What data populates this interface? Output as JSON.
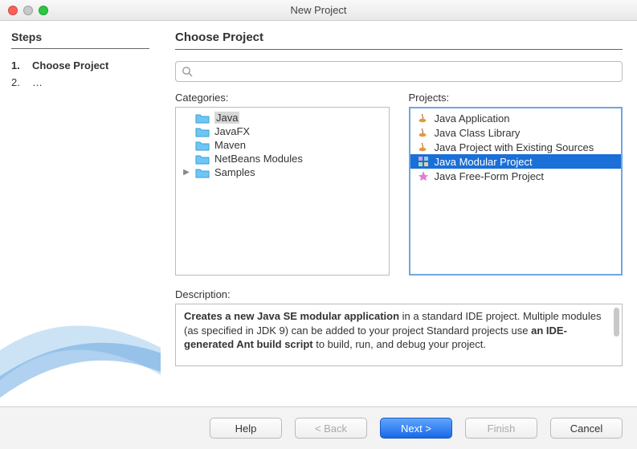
{
  "window": {
    "title": "New Project"
  },
  "steps": {
    "heading": "Steps",
    "items": [
      {
        "num": "1.",
        "label": "Choose Project",
        "current": true
      },
      {
        "num": "2.",
        "label": "…",
        "current": false
      }
    ]
  },
  "content": {
    "heading": "Choose Project",
    "search": {
      "placeholder": ""
    },
    "categories_label": "Categories:",
    "projects_label": "Projects:",
    "categories": [
      {
        "label": "Java",
        "expandable": false,
        "selected": true
      },
      {
        "label": "JavaFX",
        "expandable": false,
        "selected": false
      },
      {
        "label": "Maven",
        "expandable": false,
        "selected": false
      },
      {
        "label": "NetBeans Modules",
        "expandable": false,
        "selected": false
      },
      {
        "label": "Samples",
        "expandable": true,
        "selected": false
      }
    ],
    "projects": [
      {
        "label": "Java Application",
        "icon": "coffee",
        "selected": false
      },
      {
        "label": "Java Class Library",
        "icon": "coffee",
        "selected": false
      },
      {
        "label": "Java Project with Existing Sources",
        "icon": "coffee",
        "selected": false
      },
      {
        "label": "Java Modular Project",
        "icon": "module",
        "selected": true
      },
      {
        "label": "Java Free-Form Project",
        "icon": "freeform",
        "selected": false
      }
    ],
    "description_label": "Description:",
    "description": {
      "line1_bold": "Creates a new Java SE modular application",
      "line1_rest": " in a standard IDE project. Multiple modules (as specified in JDK 9) can be added to your project Standard projects use ",
      "line2_bold": "an IDE-generated Ant build script",
      "line2_rest": " to build, run, and debug your project."
    }
  },
  "buttons": {
    "help": "Help",
    "back": "< Back",
    "next": "Next >",
    "finish": "Finish",
    "cancel": "Cancel"
  }
}
